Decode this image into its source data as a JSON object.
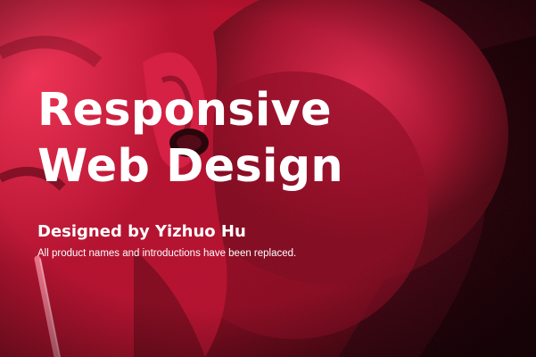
{
  "hero": {
    "title_line1": "Responsive",
    "title_line2": "Web Design",
    "designer": "Designed by Yizhuo Hu",
    "note": "All product names and introductions have been replaced."
  },
  "colors": {
    "tint": "#d4143a",
    "shadow": "#2a0008",
    "text": "#ffffff"
  }
}
